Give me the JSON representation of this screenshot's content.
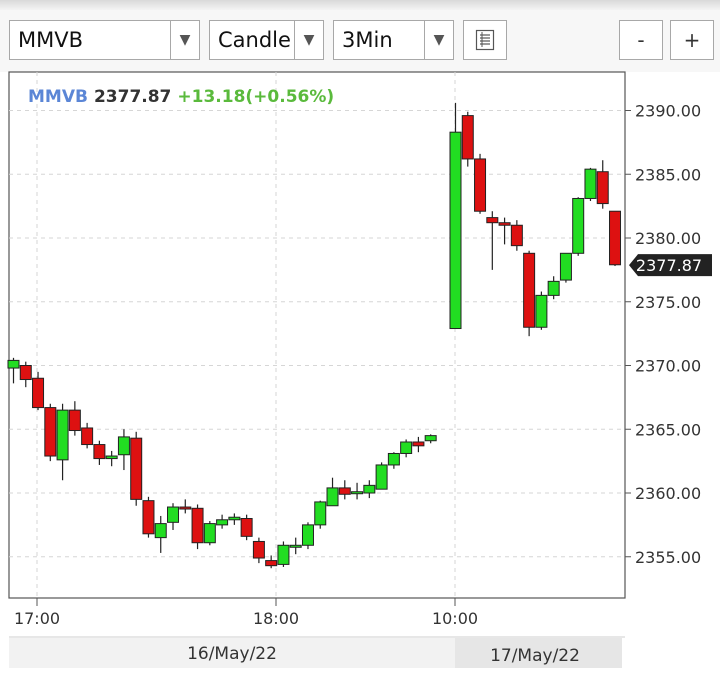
{
  "toolbar": {
    "symbol_select": "MMVB",
    "chart_type_select": "Candle",
    "interval_select": "3Min",
    "zoom_out_label": "-",
    "zoom_in_label": "+",
    "dropdown_icon": "chevron-down-icon",
    "options_icon": "list-icon"
  },
  "quote": {
    "symbol": "MMVB",
    "price": "2377.87",
    "change": "+13.18(+0.56%)"
  },
  "colors": {
    "up": "#22dd22",
    "down": "#dd1111",
    "symbol": "#5b86d6",
    "change": "#5aba3c",
    "price_tag": "#222222"
  },
  "chart_data": {
    "type": "candlestick",
    "title": "",
    "xlabel": "",
    "ylabel": "",
    "ylim": [
      2351.5,
      2392.6
    ],
    "yticks": [
      "2390.00",
      "2385.00",
      "2380.00",
      "2375.00",
      "2370.00",
      "2365.00",
      "2360.00",
      "2355.00"
    ],
    "grid": true,
    "last_price_label": "2377.87",
    "time_labels": [
      "17:00",
      "18:00",
      "10:00"
    ],
    "date_labels": [
      "16/May/22",
      "17/May/22"
    ],
    "sessions": [
      {
        "date": "16/May/22",
        "candles": [
          {
            "o": 2369.8,
            "h": 2370.6,
            "l": 2368.6,
            "c": 2370.4
          },
          {
            "o": 2370.0,
            "h": 2370.3,
            "l": 2368.3,
            "c": 2368.9
          },
          {
            "o": 2369.0,
            "h": 2369.5,
            "l": 2366.5,
            "c": 2366.7
          },
          {
            "o": 2366.7,
            "h": 2367.0,
            "l": 2362.5,
            "c": 2362.9
          },
          {
            "o": 2362.6,
            "h": 2367.0,
            "l": 2361.0,
            "c": 2366.5
          },
          {
            "o": 2366.5,
            "h": 2367.2,
            "l": 2364.5,
            "c": 2364.9
          },
          {
            "o": 2365.1,
            "h": 2365.5,
            "l": 2363.5,
            "c": 2363.8
          },
          {
            "o": 2363.8,
            "h": 2364.1,
            "l": 2362.2,
            "c": 2362.7
          },
          {
            "o": 2362.7,
            "h": 2363.3,
            "l": 2362.1,
            "c": 2362.9
          },
          {
            "o": 2363.0,
            "h": 2365.0,
            "l": 2361.8,
            "c": 2364.4
          },
          {
            "o": 2364.3,
            "h": 2364.8,
            "l": 2359.0,
            "c": 2359.5
          },
          {
            "o": 2359.4,
            "h": 2359.7,
            "l": 2356.5,
            "c": 2356.8
          },
          {
            "o": 2356.5,
            "h": 2358.2,
            "l": 2355.3,
            "c": 2357.6
          },
          {
            "o": 2357.7,
            "h": 2359.2,
            "l": 2357.1,
            "c": 2358.9
          },
          {
            "o": 2358.9,
            "h": 2359.5,
            "l": 2358.4,
            "c": 2358.8
          },
          {
            "o": 2358.8,
            "h": 2359.1,
            "l": 2355.6,
            "c": 2356.1
          },
          {
            "o": 2356.1,
            "h": 2357.8,
            "l": 2355.9,
            "c": 2357.6
          },
          {
            "o": 2357.5,
            "h": 2358.3,
            "l": 2357.2,
            "c": 2357.9
          },
          {
            "o": 2357.9,
            "h": 2358.4,
            "l": 2357.5,
            "c": 2358.1
          },
          {
            "o": 2358.0,
            "h": 2358.3,
            "l": 2356.3,
            "c": 2356.6
          },
          {
            "o": 2356.2,
            "h": 2356.5,
            "l": 2354.5,
            "c": 2354.9
          },
          {
            "o": 2354.7,
            "h": 2355.1,
            "l": 2354.1,
            "c": 2354.3
          },
          {
            "o": 2354.4,
            "h": 2356.2,
            "l": 2354.2,
            "c": 2355.9
          },
          {
            "o": 2355.8,
            "h": 2356.5,
            "l": 2355.2,
            "c": 2355.9
          },
          {
            "o": 2355.9,
            "h": 2357.7,
            "l": 2355.6,
            "c": 2357.5
          },
          {
            "o": 2357.5,
            "h": 2359.4,
            "l": 2357.2,
            "c": 2359.3
          },
          {
            "o": 2359.0,
            "h": 2361.2,
            "l": 2359.0,
            "c": 2360.4
          },
          {
            "o": 2360.4,
            "h": 2361.0,
            "l": 2359.5,
            "c": 2359.9
          },
          {
            "o": 2360.0,
            "h": 2360.8,
            "l": 2359.5,
            "c": 2360.1
          },
          {
            "o": 2360.0,
            "h": 2361.0,
            "l": 2359.6,
            "c": 2360.6
          },
          {
            "o": 2360.3,
            "h": 2362.4,
            "l": 2360.3,
            "c": 2362.2
          },
          {
            "o": 2362.2,
            "h": 2363.2,
            "l": 2361.9,
            "c": 2363.1
          },
          {
            "o": 2363.1,
            "h": 2364.2,
            "l": 2362.8,
            "c": 2364.0
          },
          {
            "o": 2364.0,
            "h": 2364.4,
            "l": 2363.2,
            "c": 2363.7
          },
          {
            "o": 2364.1,
            "h": 2364.6,
            "l": 2363.9,
            "c": 2364.5
          }
        ]
      },
      {
        "date": "17/May/22",
        "candles": [
          {
            "o": 2372.9,
            "h": 2390.6,
            "l": 2372.9,
            "c": 2388.3
          },
          {
            "o": 2389.6,
            "h": 2389.9,
            "l": 2385.6,
            "c": 2386.2
          },
          {
            "o": 2386.2,
            "h": 2386.6,
            "l": 2381.9,
            "c": 2382.1
          },
          {
            "o": 2381.6,
            "h": 2382.1,
            "l": 2377.5,
            "c": 2381.2
          },
          {
            "o": 2381.2,
            "h": 2381.6,
            "l": 2379.5,
            "c": 2381.0
          },
          {
            "o": 2381.0,
            "h": 2381.4,
            "l": 2379.0,
            "c": 2379.4
          },
          {
            "o": 2378.8,
            "h": 2379.0,
            "l": 2372.3,
            "c": 2373.0
          },
          {
            "o": 2373.0,
            "h": 2375.8,
            "l": 2372.8,
            "c": 2375.5
          },
          {
            "o": 2375.5,
            "h": 2377.0,
            "l": 2375.2,
            "c": 2376.6
          },
          {
            "o": 2376.7,
            "h": 2378.8,
            "l": 2376.5,
            "c": 2378.8
          },
          {
            "o": 2378.8,
            "h": 2383.2,
            "l": 2378.6,
            "c": 2383.1
          },
          {
            "o": 2383.1,
            "h": 2385.5,
            "l": 2382.9,
            "c": 2385.4
          },
          {
            "o": 2385.2,
            "h": 2386.1,
            "l": 2382.3,
            "c": 2382.7
          },
          {
            "o": 2382.1,
            "h": 2382.1,
            "l": 2377.8,
            "c": 2377.9
          }
        ]
      }
    ]
  }
}
